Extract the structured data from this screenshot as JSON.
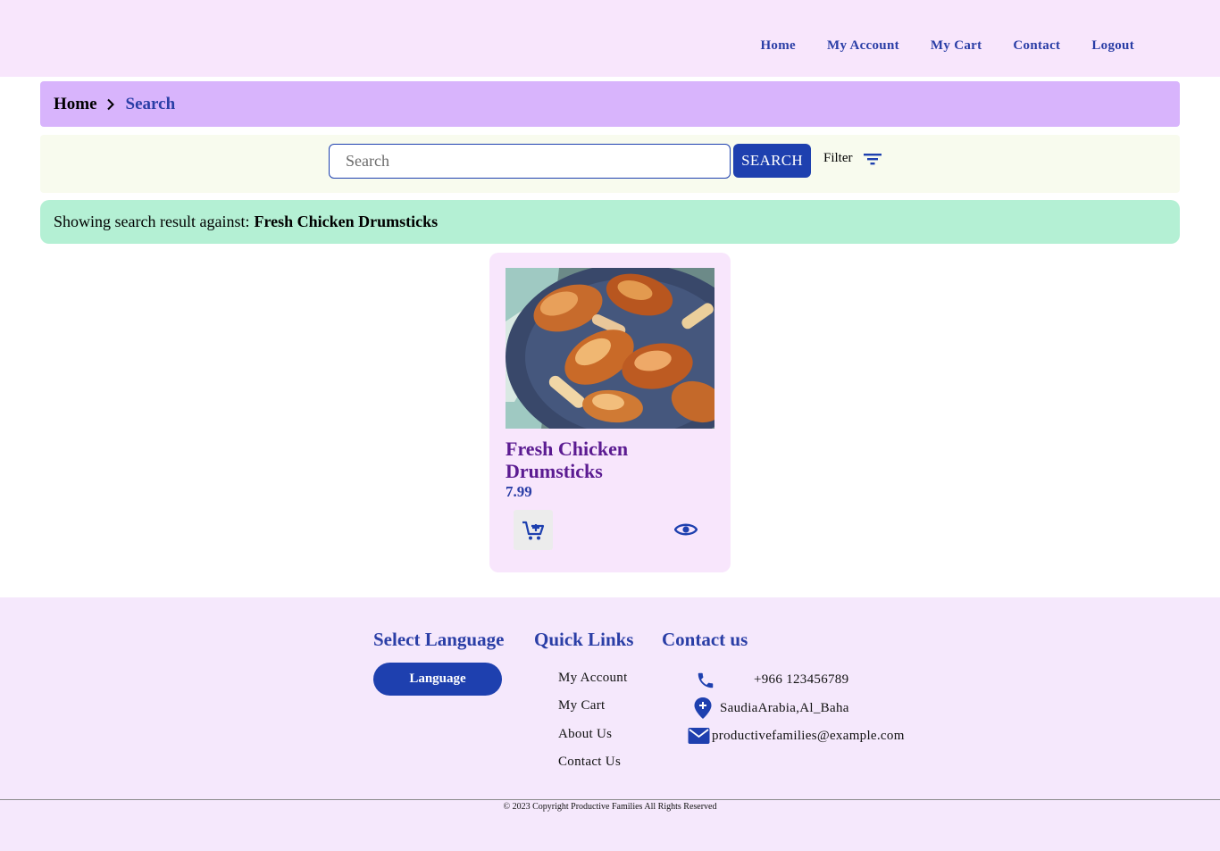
{
  "nav": {
    "items": [
      {
        "label": "Home"
      },
      {
        "label": "My Account"
      },
      {
        "label": "My Cart"
      },
      {
        "label": "Contact"
      },
      {
        "label": "Logout"
      }
    ]
  },
  "breadcrumb": {
    "home": "Home",
    "current": "Search"
  },
  "search": {
    "placeholder": "Search",
    "value": "",
    "button_label": "SEARCH",
    "filter_label": "Filter"
  },
  "result": {
    "prefix": "Showing search result against:",
    "query": "Fresh Chicken Drumsticks"
  },
  "products": [
    {
      "name": "Fresh Chicken Drumsticks",
      "price": "7.99",
      "image": "chicken-drumsticks-photo",
      "cart_icon": "add-to-cart-icon",
      "view_icon": "eye-icon"
    }
  ],
  "footer": {
    "language": {
      "heading": "Select Language",
      "button_label": "Language"
    },
    "quick_links": {
      "heading": "Quick Links",
      "items": [
        "My Account",
        "My Cart",
        "About Us",
        "Contact Us"
      ]
    },
    "contact": {
      "heading": "Contact us",
      "phone": "+966 123456789",
      "address": "SaudiaArabia,Al_Baha",
      "email": "productivefamilies@example.com"
    },
    "copyright": "© 2023 Copyright Productive Families All Rights Reserved"
  },
  "colors": {
    "brand_blue": "#1e40af",
    "link_blue": "#2a3ea6",
    "title_purple": "#5b1b91",
    "header_bg": "#f8e6fc",
    "breadcrumb_bg": "#d8b4fc",
    "result_bg": "#b4f0d4"
  }
}
